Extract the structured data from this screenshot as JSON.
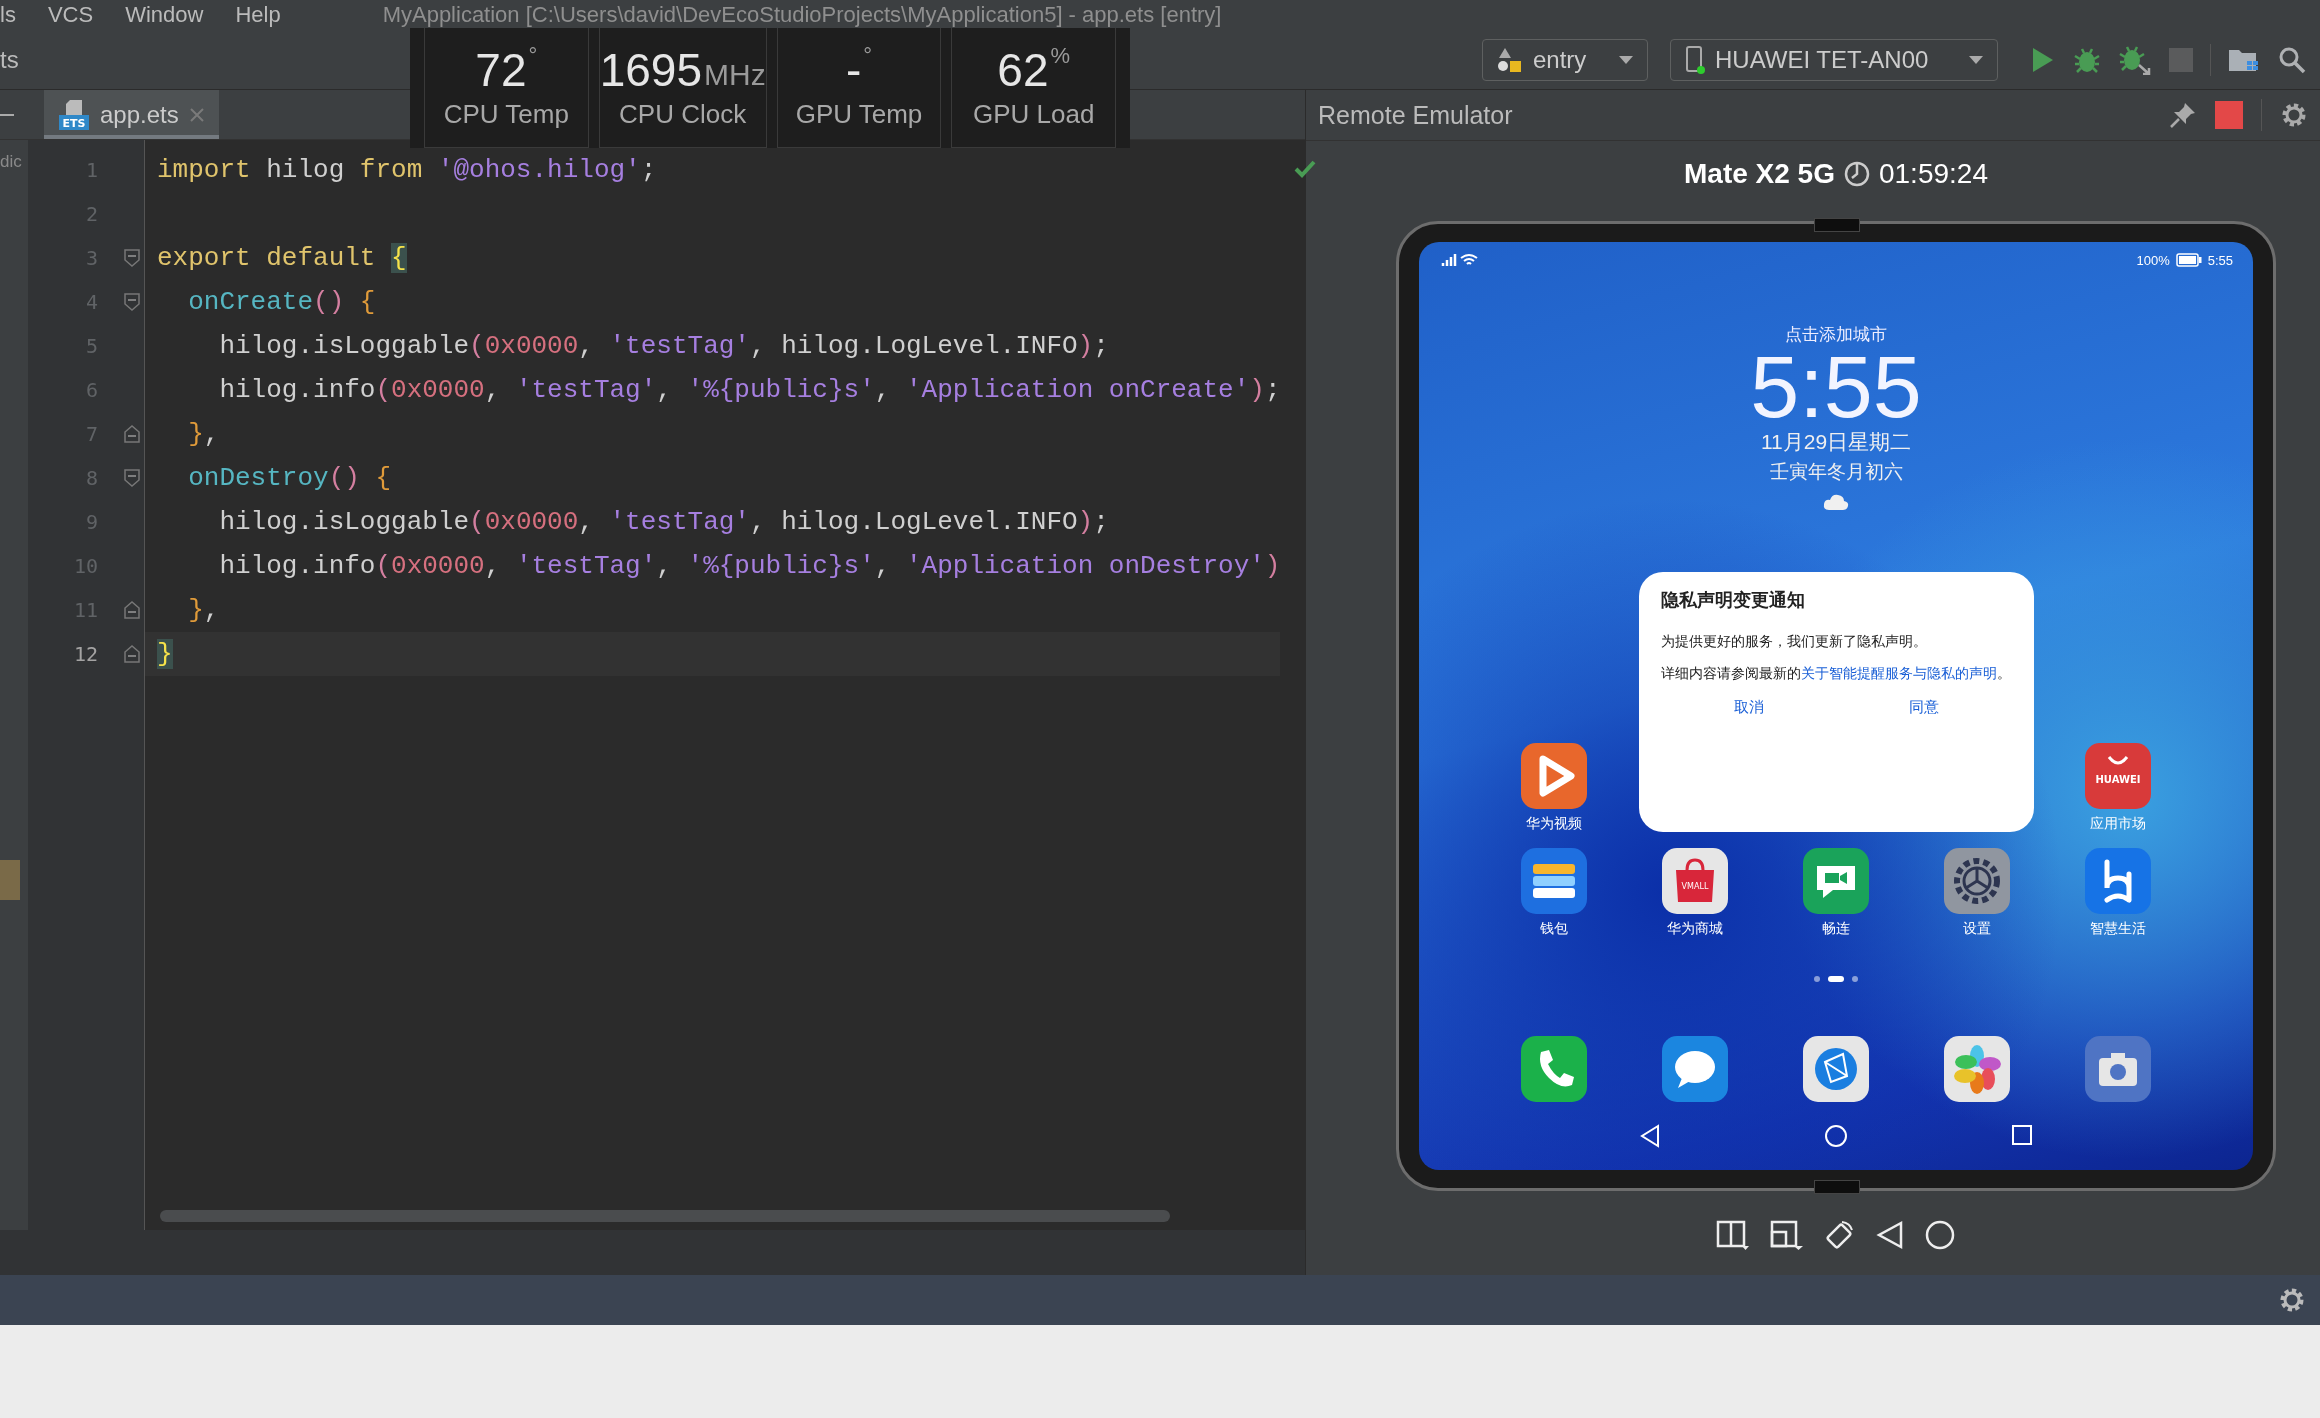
{
  "menu_bar": {
    "items": [
      {
        "label": "ls"
      },
      {
        "label": "VCS"
      },
      {
        "label": "Window"
      },
      {
        "label": "Help"
      }
    ],
    "title": "MyApplication [C:\\Users\\david\\DevEcoStudioProjects\\MyApplication5] - app.ets [entry]"
  },
  "toolbar": {
    "left_fragment": "ts",
    "run_config": "entry",
    "device": "HUAWEI TET-AN00"
  },
  "perf_overlay": [
    {
      "value": "72",
      "unit": "°",
      "label": "CPU Temp"
    },
    {
      "value": "1695",
      "unit": "MHz",
      "label": "CPU Clock"
    },
    {
      "value": "-",
      "unit": "°",
      "label": "GPU Temp"
    },
    {
      "value": "62",
      "unit": "%",
      "label": "GPU Load"
    }
  ],
  "editor": {
    "side_fragment": "dic",
    "tabs": [
      {
        "label": "app.ets",
        "icon_text": "ETS",
        "selected": true
      }
    ],
    "lines": [
      {
        "number": "1",
        "current": false,
        "fold_start": false,
        "fold_end": false,
        "tokens": [
          {
            "kind": "keyword",
            "text": "import"
          },
          {
            "kind": "plain",
            "text": " hilog "
          },
          {
            "kind": "keyword",
            "text": "from "
          },
          {
            "kind": "string",
            "text": "'@ohos.hilog'"
          },
          {
            "kind": "plain",
            "text": ";"
          }
        ]
      },
      {
        "number": "2",
        "current": false,
        "fold_start": false,
        "fold_end": false
      },
      {
        "number": "3",
        "current": false,
        "fold_start": true,
        "fold_end": false,
        "tokens": [
          {
            "kind": "keyword",
            "text": "export default "
          },
          {
            "kind": "matched",
            "text": "{"
          }
        ]
      },
      {
        "number": "4",
        "current": false,
        "fold_start": true,
        "fold_end": false,
        "tokens": [
          {
            "kind": "method",
            "text": "  onCreate"
          },
          {
            "kind": "paren",
            "text": "() "
          },
          {
            "kind": "brace",
            "text": "{"
          }
        ]
      },
      {
        "number": "5",
        "current": false,
        "fold_start": false,
        "fold_end": false,
        "tokens": [
          {
            "kind": "plain",
            "text": "    hilog.isLoggable"
          },
          {
            "kind": "paren",
            "text": "("
          },
          {
            "kind": "number",
            "text": "0x0000"
          },
          {
            "kind": "plain",
            "text": ", "
          },
          {
            "kind": "string",
            "text": "'testTag'"
          },
          {
            "kind": "plain",
            "text": ", hilog.LogLevel.INFO"
          },
          {
            "kind": "paren",
            "text": ")"
          },
          {
            "kind": "plain",
            "text": ";"
          }
        ]
      },
      {
        "number": "6",
        "current": false,
        "fold_start": false,
        "fold_end": false,
        "tokens": [
          {
            "kind": "plain",
            "text": "    hilog.info"
          },
          {
            "kind": "paren",
            "text": "("
          },
          {
            "kind": "number",
            "text": "0x0000"
          },
          {
            "kind": "plain",
            "text": ", "
          },
          {
            "kind": "string",
            "text": "'testTag'"
          },
          {
            "kind": "plain",
            "text": ", "
          },
          {
            "kind": "string",
            "text": "'%{public}s'"
          },
          {
            "kind": "plain",
            "text": ", "
          },
          {
            "kind": "string",
            "text": "'Application onCreate'"
          },
          {
            "kind": "paren",
            "text": ")"
          },
          {
            "kind": "plain",
            "text": ";"
          }
        ]
      },
      {
        "number": "7",
        "current": false,
        "fold_start": false,
        "fold_end": true,
        "tokens": [
          {
            "kind": "brace",
            "text": "  }"
          },
          {
            "kind": "plain",
            "text": ","
          }
        ]
      },
      {
        "number": "8",
        "current": false,
        "fold_start": true,
        "fold_end": false,
        "tokens": [
          {
            "kind": "method",
            "text": "  onDestroy"
          },
          {
            "kind": "paren",
            "text": "() "
          },
          {
            "kind": "brace",
            "text": "{"
          }
        ]
      },
      {
        "number": "9",
        "current": false,
        "fold_start": false,
        "fold_end": false,
        "tokens": [
          {
            "kind": "plain",
            "text": "    hilog.isLoggable"
          },
          {
            "kind": "paren",
            "text": "("
          },
          {
            "kind": "number",
            "text": "0x0000"
          },
          {
            "kind": "plain",
            "text": ", "
          },
          {
            "kind": "string",
            "text": "'testTag'"
          },
          {
            "kind": "plain",
            "text": ", hilog.LogLevel.INFO"
          },
          {
            "kind": "paren",
            "text": ")"
          },
          {
            "kind": "plain",
            "text": ";"
          }
        ]
      },
      {
        "number": "10",
        "current": false,
        "fold_start": false,
        "fold_end": false,
        "tokens": [
          {
            "kind": "plain",
            "text": "    hilog.info"
          },
          {
            "kind": "paren",
            "text": "("
          },
          {
            "kind": "number",
            "text": "0x0000"
          },
          {
            "kind": "plain",
            "text": ", "
          },
          {
            "kind": "string",
            "text": "'testTag'"
          },
          {
            "kind": "plain",
            "text": ", "
          },
          {
            "kind": "string",
            "text": "'%{public}s'"
          },
          {
            "kind": "plain",
            "text": ", "
          },
          {
            "kind": "string",
            "text": "'Application onDestroy'"
          },
          {
            "kind": "paren",
            "text": ")"
          }
        ]
      },
      {
        "number": "11",
        "current": false,
        "fold_start": false,
        "fold_end": true,
        "tokens": [
          {
            "kind": "brace",
            "text": "  }"
          },
          {
            "kind": "plain",
            "text": ","
          }
        ]
      },
      {
        "number": "12",
        "current": true,
        "fold_start": false,
        "fold_end": true,
        "tokens": [
          {
            "kind": "matched",
            "text": "}"
          }
        ]
      }
    ]
  },
  "emulator": {
    "title": "Remote Emulator",
    "device_name": "Mate X2 5G",
    "timer": "01:59:24",
    "phone": {
      "status_bar": {
        "battery": "100%",
        "time": "5:55"
      },
      "lock": {
        "city": "点击添加城市",
        "time": "5:55",
        "date": "11月29日星期二",
        "lunar": "壬寅年冬月初六"
      },
      "dialog": {
        "title": "隐私声明变更通知",
        "message": "为提供更好的服务，我们更新了隐私声明。",
        "detail_before": "详细内容请参阅最新的",
        "detail_link": "关于智能提醒服务与隐私的声明",
        "detail_after": "。",
        "buttons": [
          "取消",
          "同意"
        ]
      },
      "home_rows": [
        [
          {
            "kind": "video",
            "label": "华为视频"
          },
          {
            "kind": "appgallery",
            "label": "应用市场",
            "icon_text": "HUAWEI"
          }
        ],
        [
          {
            "kind": "wallet",
            "label": "钱包"
          },
          {
            "kind": "vmall",
            "label": "华为商城",
            "icon_text": "VMALL"
          },
          {
            "kind": "meetime",
            "label": "畅连"
          },
          {
            "kind": "settings",
            "label": "设置"
          },
          {
            "kind": "smartlife",
            "label": "智慧生活"
          }
        ]
      ],
      "pages": [
        {
          "selected": false
        },
        {
          "selected": true
        },
        {
          "selected": false
        }
      ],
      "dock": [
        {
          "kind": "phone"
        },
        {
          "kind": "messages"
        },
        {
          "kind": "browser"
        },
        {
          "kind": "gallery"
        },
        {
          "kind": "camera"
        }
      ]
    }
  }
}
